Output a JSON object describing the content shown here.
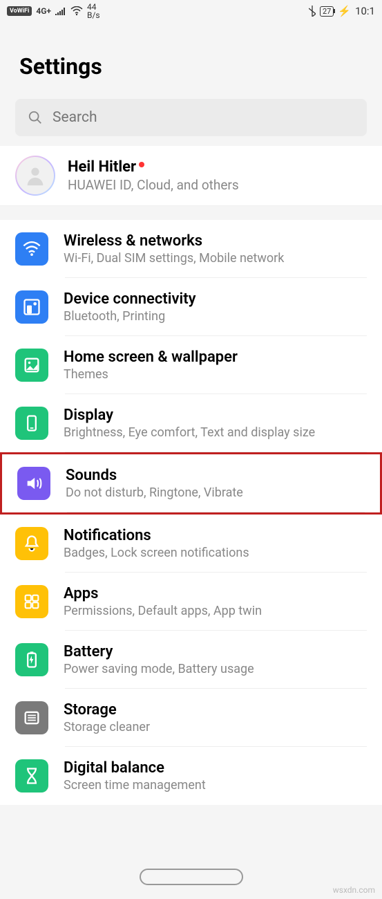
{
  "status": {
    "vowifi": "VoWiFi",
    "signal": "4G+",
    "speed_top": "44",
    "speed_bot": "B/s",
    "battery": "27",
    "time": "10:1"
  },
  "header": {
    "title": "Settings"
  },
  "search": {
    "placeholder": "Search"
  },
  "account": {
    "name": "Heil Hitler",
    "sub": "HUAWEI ID, Cloud, and others"
  },
  "items": [
    {
      "title": "Wireless & networks",
      "sub": "Wi-Fi, Dual SIM settings, Mobile network"
    },
    {
      "title": "Device connectivity",
      "sub": "Bluetooth, Printing"
    },
    {
      "title": "Home screen & wallpaper",
      "sub": "Themes"
    },
    {
      "title": "Display",
      "sub": "Brightness, Eye comfort, Text and display size"
    },
    {
      "title": "Sounds",
      "sub": "Do not disturb, Ringtone, Vibrate"
    },
    {
      "title": "Notifications",
      "sub": "Badges, Lock screen notifications"
    },
    {
      "title": "Apps",
      "sub": "Permissions, Default apps, App twin"
    },
    {
      "title": "Battery",
      "sub": "Power saving mode, Battery usage"
    },
    {
      "title": "Storage",
      "sub": "Storage cleaner"
    },
    {
      "title": "Digital balance",
      "sub": "Screen time management"
    }
  ],
  "watermark": "wsxdn.com"
}
